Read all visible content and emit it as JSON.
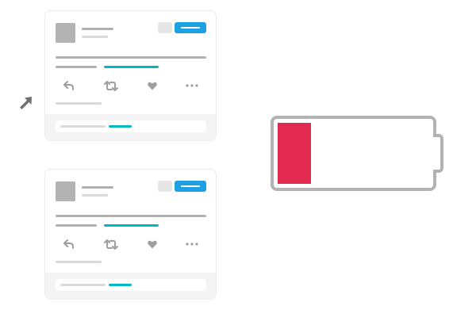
{
  "colors": {
    "page_background": "#ffffff",
    "card_border": "#ececec",
    "skeleton_dark": "#b0b0b0",
    "skeleton_light": "#dadada",
    "avatar": "#b3b3b3",
    "ghost_button": "#e6e6e6",
    "primary_button": "#1da1e2",
    "link_accent": "#00b9c0",
    "icon": "#9e9e9e",
    "footer_background": "#f4f4f4",
    "cursor": "#707070",
    "battery_outline": "#b3b3b3",
    "battery_fill": "#e2294f"
  },
  "cards": [
    {
      "avatar_icon": "avatar-placeholder",
      "actions": [
        "reply-icon",
        "retweet-icon",
        "like-icon",
        "more-icon"
      ]
    },
    {
      "avatar_icon": "avatar-placeholder",
      "actions": [
        "reply-icon",
        "retweet-icon",
        "like-icon",
        "more-icon"
      ]
    }
  ],
  "cursor_icon": "arrow-pointer-icon",
  "battery": {
    "icon": "battery-low-icon",
    "charge_fraction": 0.22
  }
}
